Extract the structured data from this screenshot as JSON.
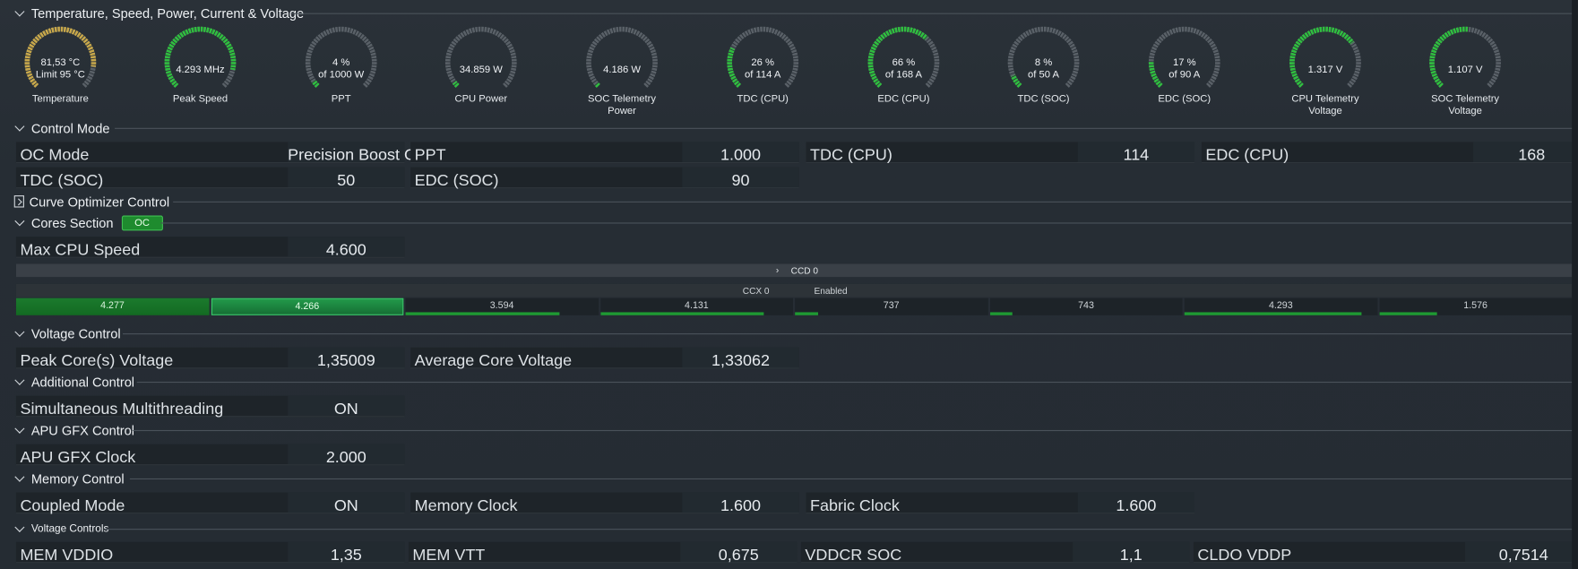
{
  "sections": {
    "temp": "Temperature, Speed, Power, Current & Voltage",
    "control": "Control Mode",
    "curve": "Curve Optimizer Control",
    "cores": "Cores Section",
    "cores_badge": "OC",
    "voltage": "Voltage Control",
    "additional": "Additional Control",
    "apu": "APU GFX Control",
    "memory": "Memory Control",
    "vcontrols": "Voltage Controls"
  },
  "gauges": [
    {
      "l1": "81,53 °C",
      "l2": "Limit 95 °C",
      "name": "Temperature",
      "fraction": 0.86,
      "color": "#c8a84a"
    },
    {
      "l1": "4.293  MHz",
      "l2": "",
      "name": "Peak Speed",
      "fraction": 0.88,
      "color": "#2fbf3f"
    },
    {
      "l1": "4 %",
      "l2": "of 1000 W",
      "name": "PPT",
      "fraction": 0.04,
      "color": "#2fbf3f"
    },
    {
      "l1": "34.859 W",
      "l2": "",
      "name": "CPU Power",
      "fraction": 0.03,
      "color": "#2fbf3f"
    },
    {
      "l1": "4.186 W",
      "l2": "",
      "name": "SOC Telemetry Power",
      "name1": "SOC Telemetry",
      "name2": "Power",
      "fraction": 0.02,
      "color": "#2fbf3f"
    },
    {
      "l1": "26 %",
      "l2": "of 114 A",
      "name": "TDC (CPU)",
      "fraction": 0.26,
      "color": "#2fbf3f"
    },
    {
      "l1": "66 %",
      "l2": "of 168 A",
      "name": "EDC (CPU)",
      "fraction": 0.66,
      "color": "#2fbf3f"
    },
    {
      "l1": "8 %",
      "l2": "of 50 A",
      "name": "TDC (SOC)",
      "fraction": 0.08,
      "color": "#2fbf3f"
    },
    {
      "l1": "17 %",
      "l2": "of 90 A",
      "name": "EDC (SOC)",
      "fraction": 0.17,
      "color": "#2fbf3f"
    },
    {
      "l1": "1.317 V",
      "l2": "",
      "name": "CPU Telemetry Voltage",
      "name1": "CPU Telemetry",
      "name2": "Voltage",
      "fraction": 0.7,
      "color": "#2fbf3f"
    },
    {
      "l1": "1.107 V",
      "l2": "",
      "name": "SOC Telemetry Voltage",
      "name1": "SOC Telemetry",
      "name2": "Voltage",
      "fraction": 0.52,
      "color": "#2fbf3f"
    }
  ],
  "control": {
    "oc_mode_label": "OC Mode",
    "oc_mode": "Precision Boost Overdrive",
    "ppt_label": "PPT",
    "ppt": "1.000",
    "tdc_cpu_label": "TDC (CPU)",
    "tdc_cpu": "114",
    "edc_cpu_label": "EDC (CPU)",
    "edc_cpu": "168",
    "tdc_soc_label": "TDC (SOC)",
    "tdc_soc": "50",
    "edc_soc_label": "EDC (SOC)",
    "edc_soc": "90"
  },
  "cores": {
    "max_speed_label": "Max CPU Speed",
    "max_speed": "4.600",
    "ccd": "CCD 0",
    "ccx": "CCX 0",
    "ccx_state": "Enabled",
    "values": [
      "4.277",
      "4.266",
      "3.594",
      "4.131",
      "737",
      "743",
      "4.293",
      "1.576"
    ],
    "load": [
      0.9,
      1.0,
      0.8,
      0.85,
      0.12,
      0.12,
      0.92,
      0.3
    ]
  },
  "voltage": {
    "peak_label": "Peak Core(s) Voltage",
    "peak": "1,35009",
    "avg_label": "Average Core Voltage",
    "avg": "1,33062"
  },
  "additional": {
    "smt_label": "Simultaneous Multithreading",
    "smt": "ON"
  },
  "apu": {
    "clock_label": "APU GFX Clock",
    "clock": "2.000"
  },
  "memory": {
    "coupled_label": "Coupled Mode",
    "coupled": "ON",
    "mclk_label": "Memory Clock",
    "mclk": "1.600",
    "fclk_label": "Fabric Clock",
    "fclk": "1.600"
  },
  "vcontrols": {
    "vddio_label": "MEM VDDIO",
    "vddio": "1,35",
    "vtt_label": "MEM VTT",
    "vtt": "0,675",
    "vddcr_label": "VDDCR SOC",
    "vddcr": "1,1",
    "cldo_label": "CLDO VDDP",
    "cldo": "0,7514"
  }
}
